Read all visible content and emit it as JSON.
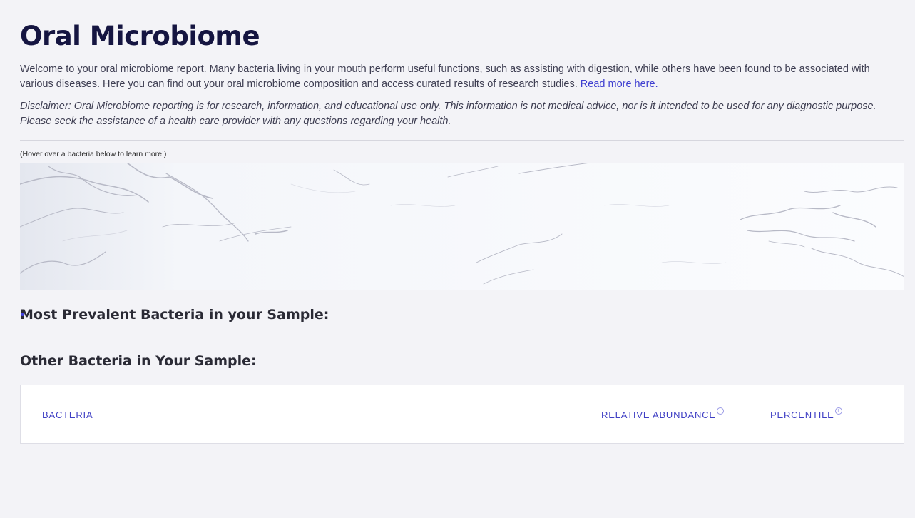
{
  "page": {
    "title": "Oral Microbiome",
    "intro_text": "Welcome to your oral microbiome report. Many bacteria living in your mouth perform useful functions, such as assisting with digestion, while others have been found to be associated with various diseases. Here you can find out your oral microbiome composition and access curated results of research studies. ",
    "read_more_label": "Read more here.",
    "disclaimer": "Disclaimer: Oral Microbiome reporting is for research, information, and educational use only. This information is not medical advice, nor is it intended to be used for any diagnostic purpose. Please seek the assistance of a health care provider with any questions regarding your health.",
    "hover_hint": "(Hover over a bacteria below to learn more!)"
  },
  "sections": {
    "prevalent_title": "Most Prevalent Bacteria in your Sample:",
    "other_title": "Other Bacteria in Your Sample:"
  },
  "table": {
    "columns": [
      {
        "label": "BACTERIA",
        "info_icon": false
      },
      {
        "label": "RELATIVE ABUNDANCE",
        "info_icon": true
      },
      {
        "label": "PERCENTILE",
        "info_icon": true
      }
    ],
    "info_icon_glyph": "i"
  },
  "colors": {
    "accent": "#3f3fd0",
    "title": "#151541",
    "background": "#f3f3f7"
  }
}
